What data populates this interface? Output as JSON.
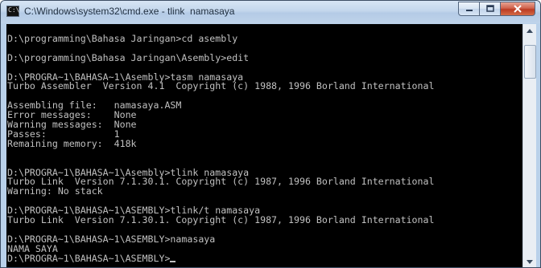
{
  "window": {
    "title": "C:\\Windows\\system32\\cmd.exe - tlink  namasaya",
    "icon_text": "C:\\"
  },
  "caption_buttons": {
    "minimize_icon": "minimize-icon",
    "maximize_icon": "maximize-icon",
    "close_icon": "close-icon"
  },
  "terminal": {
    "lines": [
      "",
      "D:\\programming\\Bahasa Jaringan>cd asembly",
      "",
      "D:\\programming\\Bahasa Jaringan\\Asembly>edit",
      "",
      "D:\\PROGRA~1\\BAHASA~1\\Asembly>tasm namasaya",
      "Turbo Assembler  Version 4.1  Copyright (c) 1988, 1996 Borland International",
      "",
      "Assembling file:   namasaya.ASM",
      "Error messages:    None",
      "Warning messages:  None",
      "Passes:            1",
      "Remaining memory:  418k",
      "",
      "",
      "D:\\PROGRA~1\\BAHASA~1\\Asembly>tlink namasaya",
      "Turbo Link  Version 7.1.30.1. Copyright (c) 1987, 1996 Borland International",
      "Warning: No stack",
      "",
      "D:\\PROGRA~1\\BAHASA~1\\ASEMBLY>tlink/t namasaya",
      "Turbo Link  Version 7.1.30.1. Copyright (c) 1987, 1996 Borland International",
      "",
      "D:\\PROGRA~1\\BAHASA~1\\ASEMBLY>namasaya",
      "NAMA SAYA",
      "D:\\PROGRA~1\\BAHASA~1\\ASEMBLY>"
    ]
  },
  "colors": {
    "terminal_background": "#000000",
    "terminal_text": "#c0c0c0",
    "window_frame": "#b9d1ea",
    "close_button": "#c94a33"
  }
}
